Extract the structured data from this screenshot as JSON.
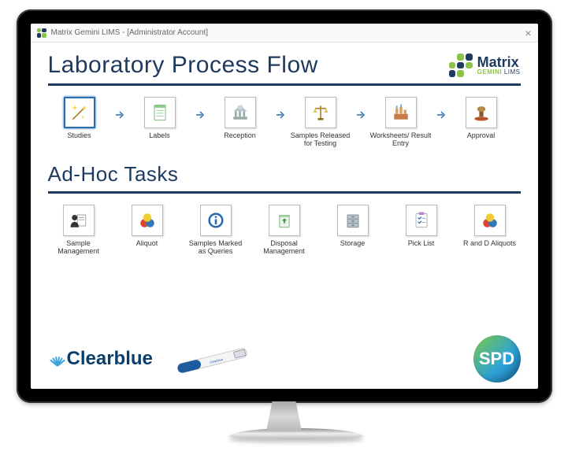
{
  "window": {
    "title": "Matrix Gemini LIMS - [Administrator Account]",
    "close_glyph": "×"
  },
  "brand": {
    "name": "Matrix",
    "subline_prefix": "GEMINI",
    "subline_suffix": " LIMS"
  },
  "headings": {
    "process_flow": "Laboratory Process Flow",
    "adhoc": "Ad-Hoc Tasks"
  },
  "process_flow": [
    {
      "key": "studies",
      "label": "Studies",
      "icon": "wand",
      "selected": true
    },
    {
      "key": "labels",
      "label": "Labels",
      "icon": "document",
      "selected": false
    },
    {
      "key": "reception",
      "label": "Reception",
      "icon": "capitol",
      "selected": false
    },
    {
      "key": "released",
      "label": "Samples Released for Testing",
      "icon": "scales",
      "selected": false
    },
    {
      "key": "worksheet",
      "label": "Worksheets/ Result Entry",
      "icon": "lab",
      "selected": false
    },
    {
      "key": "approval",
      "label": "Approval",
      "icon": "stamp",
      "selected": false
    }
  ],
  "adhoc_tasks": [
    {
      "key": "sample-mgmt",
      "label": "Sample Management",
      "icon": "person-paper"
    },
    {
      "key": "aliquot",
      "label": "Aliquot",
      "icon": "spheres"
    },
    {
      "key": "queries",
      "label": "Samples Marked as Queries",
      "icon": "info"
    },
    {
      "key": "disposal",
      "label": "Disposal Management",
      "icon": "recycle-bin"
    },
    {
      "key": "storage",
      "label": "Storage",
      "icon": "drawers"
    },
    {
      "key": "picklist",
      "label": "Pick List",
      "icon": "checklist"
    },
    {
      "key": "rnd-aliquot",
      "label": "R and D Aliquots",
      "icon": "spheres"
    }
  ],
  "footer": {
    "clearblue": "Clearblue",
    "spd": "SPD"
  }
}
